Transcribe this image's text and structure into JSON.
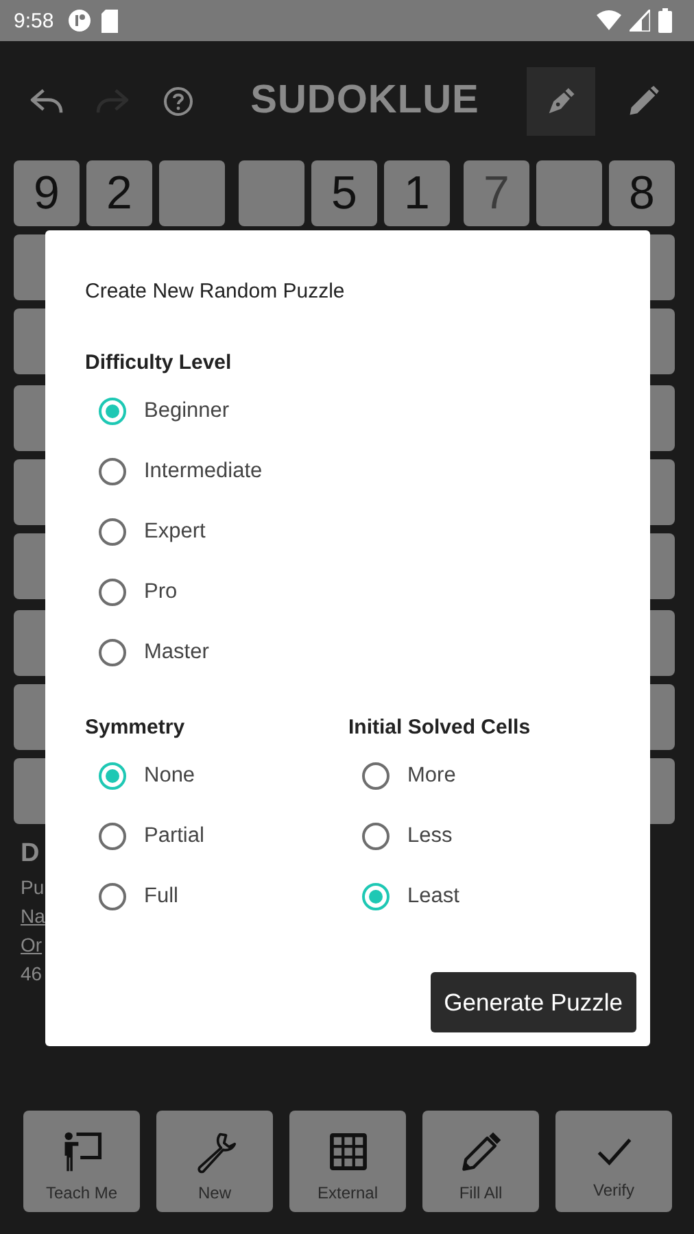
{
  "status_bar": {
    "time": "9:58"
  },
  "toolbar": {
    "title": "SUDOKLUE",
    "redo": {
      "disabled": true
    },
    "input_modes": [
      {
        "kind": "pen",
        "selected": true
      },
      {
        "kind": "pencil",
        "selected": false
      }
    ]
  },
  "grid": {
    "first_row": [
      {
        "value": "9",
        "given": true
      },
      {
        "value": "2",
        "given": true
      },
      {
        "kind": "empty"
      },
      {
        "kind": "empty"
      },
      {
        "value": "5",
        "given": true
      },
      {
        "value": "1",
        "given": true
      },
      {
        "value": "7",
        "given": false
      },
      {
        "kind": "empty"
      },
      {
        "value": "8",
        "given": true
      }
    ]
  },
  "puzzle_info": [
    {
      "kind": "heading",
      "text": "D"
    },
    {
      "kind": "text",
      "text": "Pu"
    },
    {
      "kind": "link",
      "text": "Na"
    },
    {
      "kind": "link",
      "text": "Or"
    },
    {
      "kind": "text",
      "text": "46"
    }
  ],
  "dialog": {
    "title": "Create New Random Puzzle",
    "difficulty": {
      "label": "Difficulty Level",
      "options": [
        {
          "label": "Beginner",
          "selected": true
        },
        {
          "label": "Intermediate",
          "selected": false
        },
        {
          "label": "Expert",
          "selected": false
        },
        {
          "label": "Pro",
          "selected": false
        },
        {
          "label": "Master",
          "selected": false
        }
      ]
    },
    "symmetry": {
      "label": "Symmetry",
      "options": [
        {
          "label": "None",
          "selected": true
        },
        {
          "label": "Partial",
          "selected": false
        },
        {
          "label": "Full",
          "selected": false
        }
      ]
    },
    "initial_solved_cells": {
      "label": "Initial Solved Cells",
      "options": [
        {
          "label": "More",
          "selected": false
        },
        {
          "label": "Less",
          "selected": false
        },
        {
          "label": "Least",
          "selected": true
        }
      ]
    },
    "button": "Generate Puzzle"
  },
  "bottom_buttons": [
    {
      "kind": "teach",
      "label": "Teach Me"
    },
    {
      "kind": "new",
      "label": "New"
    },
    {
      "kind": "external",
      "label": "External"
    },
    {
      "kind": "fill",
      "label": "Fill All"
    },
    {
      "kind": "verify",
      "label": "Verify"
    }
  ]
}
